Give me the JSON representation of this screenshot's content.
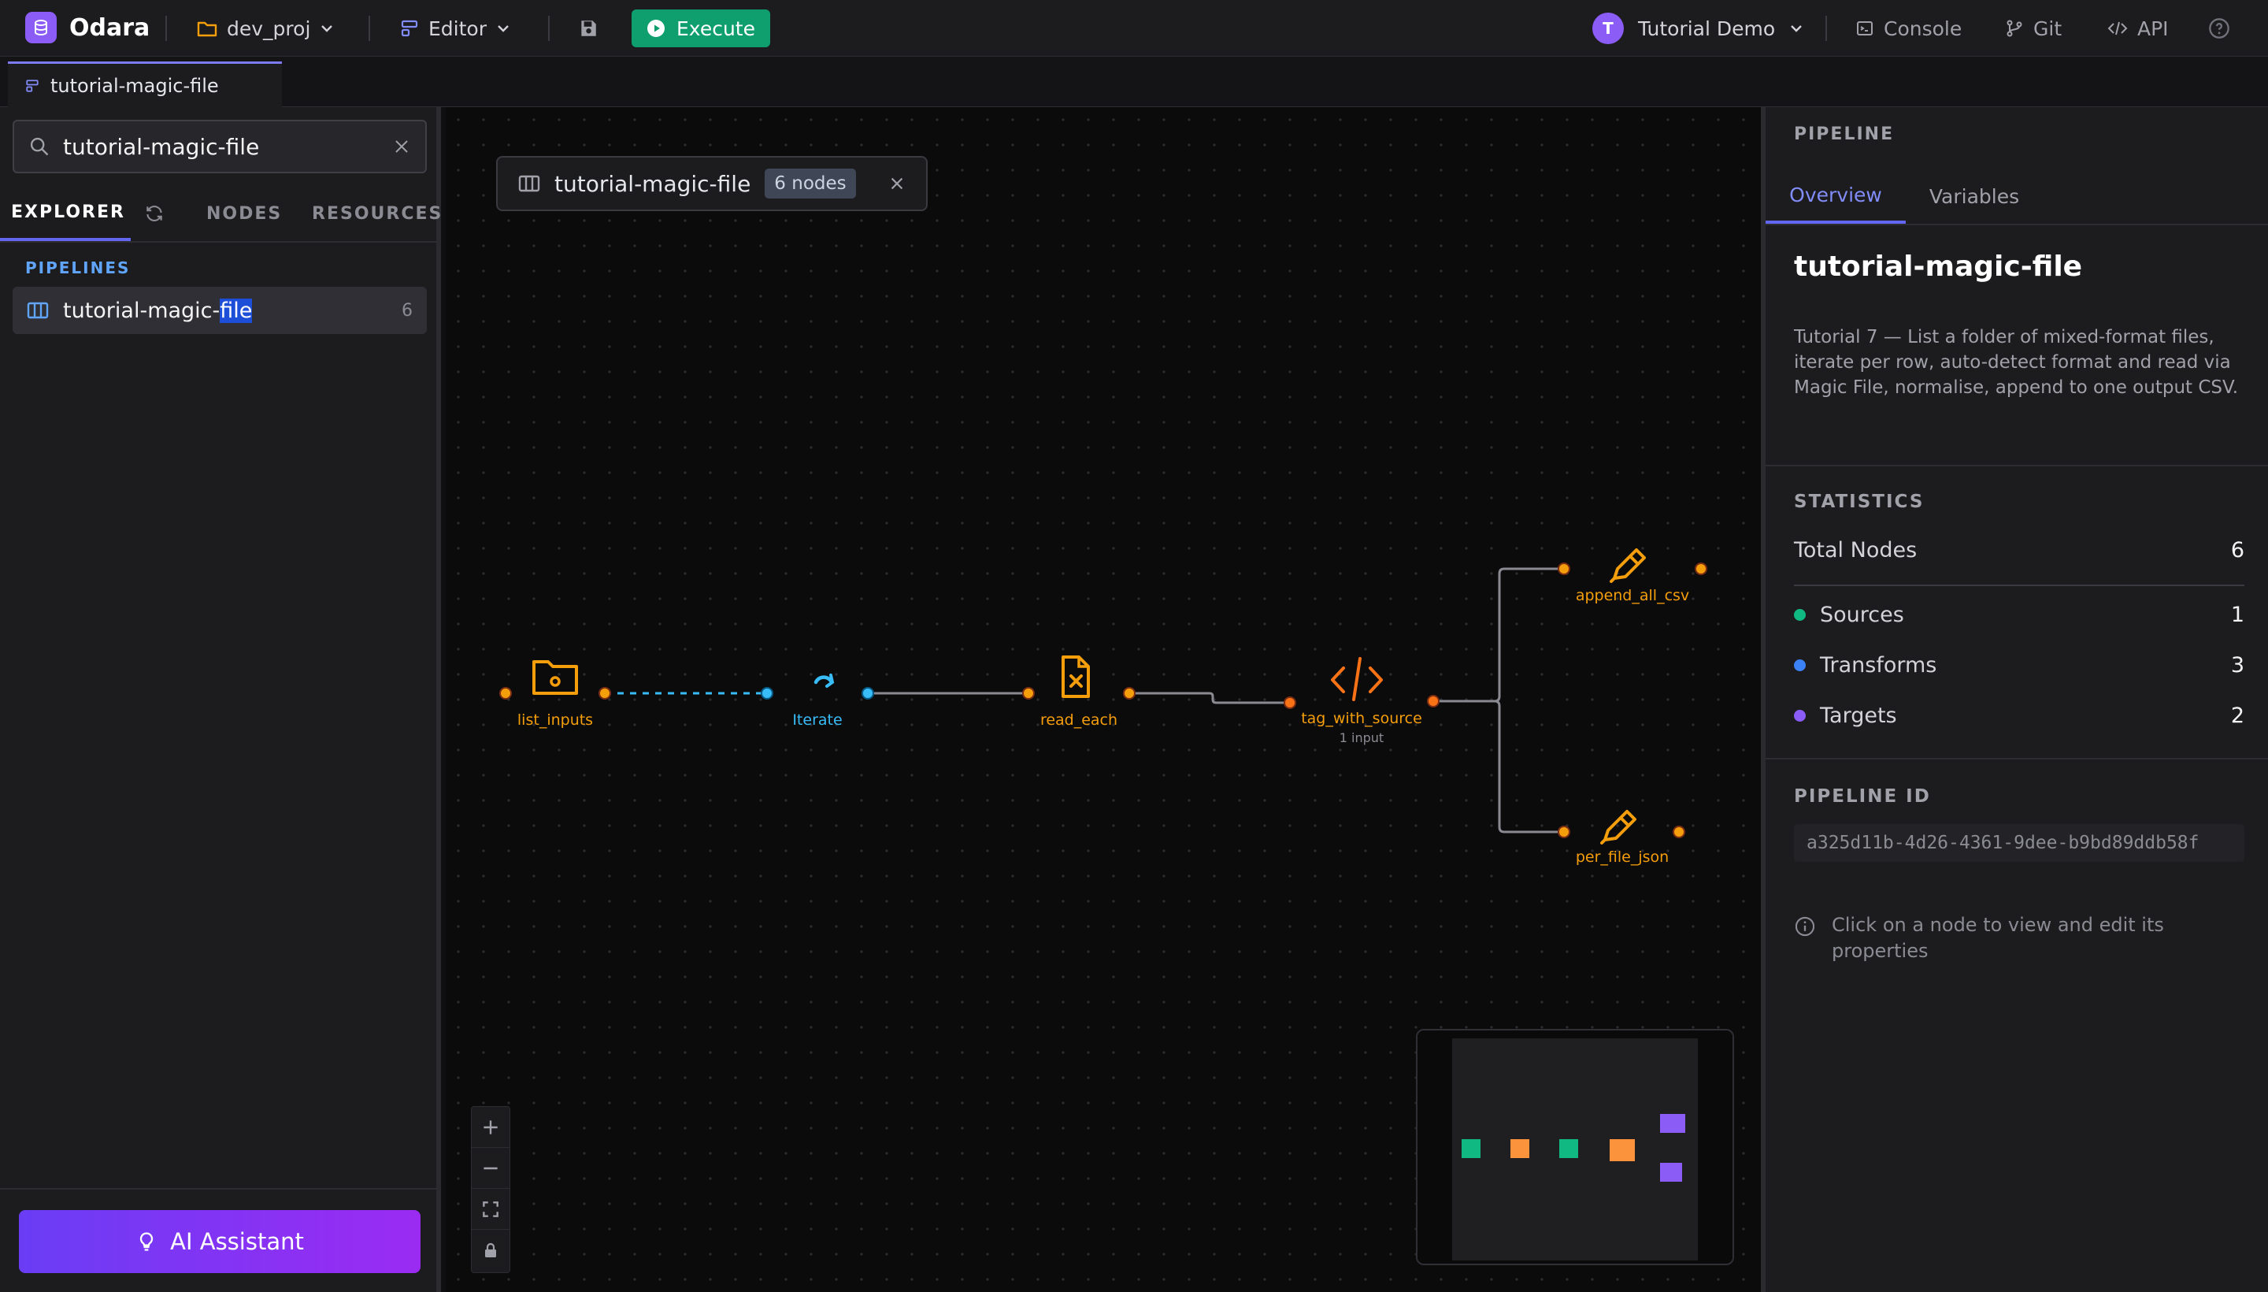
{
  "app": {
    "name": "Odara"
  },
  "toolbar": {
    "project": "dev_proj",
    "mode": "Editor",
    "execute_label": "Execute",
    "user_initial": "T",
    "user_name": "Tutorial Demo",
    "console_label": "Console",
    "git_label": "Git",
    "api_label": "API"
  },
  "tab": {
    "label": "tutorial-magic-file"
  },
  "sidebar": {
    "search_value": "tutorial-magic-file",
    "tabs": [
      "EXPLORER",
      "NODES",
      "RESOURCES"
    ],
    "section": "PIPELINES",
    "pipeline": {
      "name_prefix": "tutorial-magic-",
      "name_match": "file",
      "count": "6"
    },
    "ai_button": "AI Assistant"
  },
  "canvas": {
    "chip_title": "tutorial-magic-file",
    "chip_badge": "6 nodes",
    "nodes": [
      {
        "label": "list_inputs",
        "icon": "folder-icon"
      },
      {
        "label": "Iterate",
        "icon": "loop-icon"
      },
      {
        "label": "read_each",
        "icon": "magic-file-icon"
      },
      {
        "label": "tag_with_source",
        "sublabel": "1 input",
        "icon": "code-icon"
      },
      {
        "label": "append_all_csv",
        "icon": "pen-icon"
      },
      {
        "label": "per_file_json",
        "icon": "pen-icon"
      }
    ]
  },
  "panel": {
    "header": "PIPELINE",
    "tabs": [
      "Overview",
      "Variables"
    ],
    "title": "tutorial-magic-file",
    "description": "Tutorial 7 — List a folder of mixed-format files, iterate per row, auto-detect format and read via Magic File, normalise, append to one output CSV.",
    "statistics_label": "STATISTICS",
    "stats": [
      {
        "label": "Total Nodes",
        "value": "6"
      },
      {
        "label": "Sources",
        "value": "1",
        "color": "#10b981"
      },
      {
        "label": "Transforms",
        "value": "3",
        "color": "#3b82f6"
      },
      {
        "label": "Targets",
        "value": "2",
        "color": "#8b5cf6"
      }
    ],
    "id_label": "PIPELINE ID",
    "pipeline_id": "a325d11b-4d26-4361-9dee-b9bd89ddb58f",
    "hint": "Click on a node to view and edit its properties"
  },
  "colors": {
    "accent": "#6366f1",
    "node": "#f59e0b",
    "iterate": "#38bdf8",
    "execute": "#0f9f6e"
  }
}
